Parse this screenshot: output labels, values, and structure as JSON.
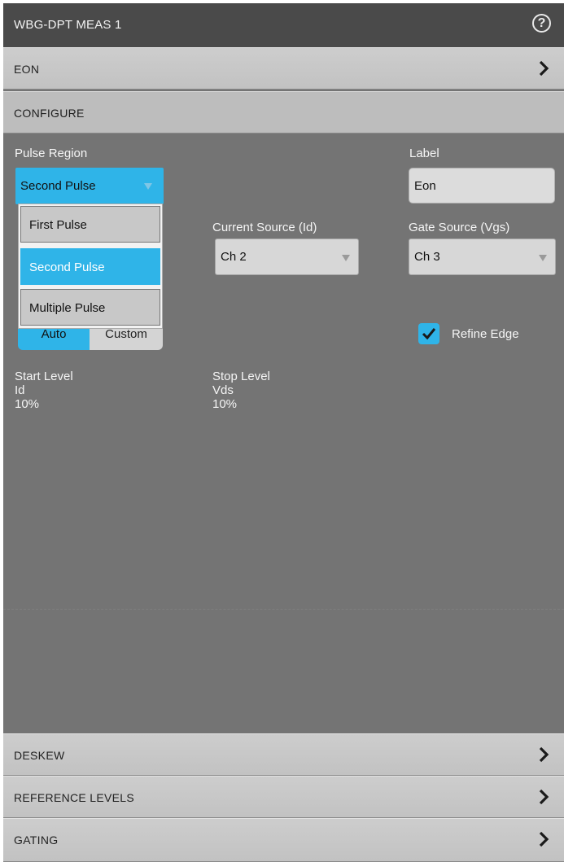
{
  "window": {
    "title": "WBG-DPT MEAS 1",
    "help_icon": "question-circle-icon"
  },
  "sections": {
    "eon": "EON",
    "configure": "CONFIGURE",
    "deskew": "DESKEW",
    "reference_levels": "REFERENCE LEVELS",
    "gating": "GATING"
  },
  "configure": {
    "pulse_region": {
      "label": "Pulse Region",
      "value": "Second Pulse",
      "options": [
        "First Pulse",
        "Second Pulse",
        "Multiple Pulse"
      ]
    },
    "label_field": {
      "label": "Label",
      "value": "Eon"
    },
    "current_source": {
      "label": "Current Source (Id)",
      "value": "Ch 2"
    },
    "gate_source": {
      "label": "Gate Source (Vgs)",
      "value": "Ch 3"
    },
    "levels_mode": {
      "auto": "Auto",
      "custom": "Custom"
    },
    "refine_edge": {
      "label": "Refine Edge",
      "checked": true
    },
    "start_level": {
      "title": "Start Level",
      "source": "Id",
      "value": "10%"
    },
    "stop_level": {
      "title": "Stop Level",
      "source": "Vds",
      "value": "10%"
    }
  },
  "colors": {
    "accent": "#2fb4e8",
    "panel": "#747474",
    "titlebar": "#4a4a4a"
  }
}
